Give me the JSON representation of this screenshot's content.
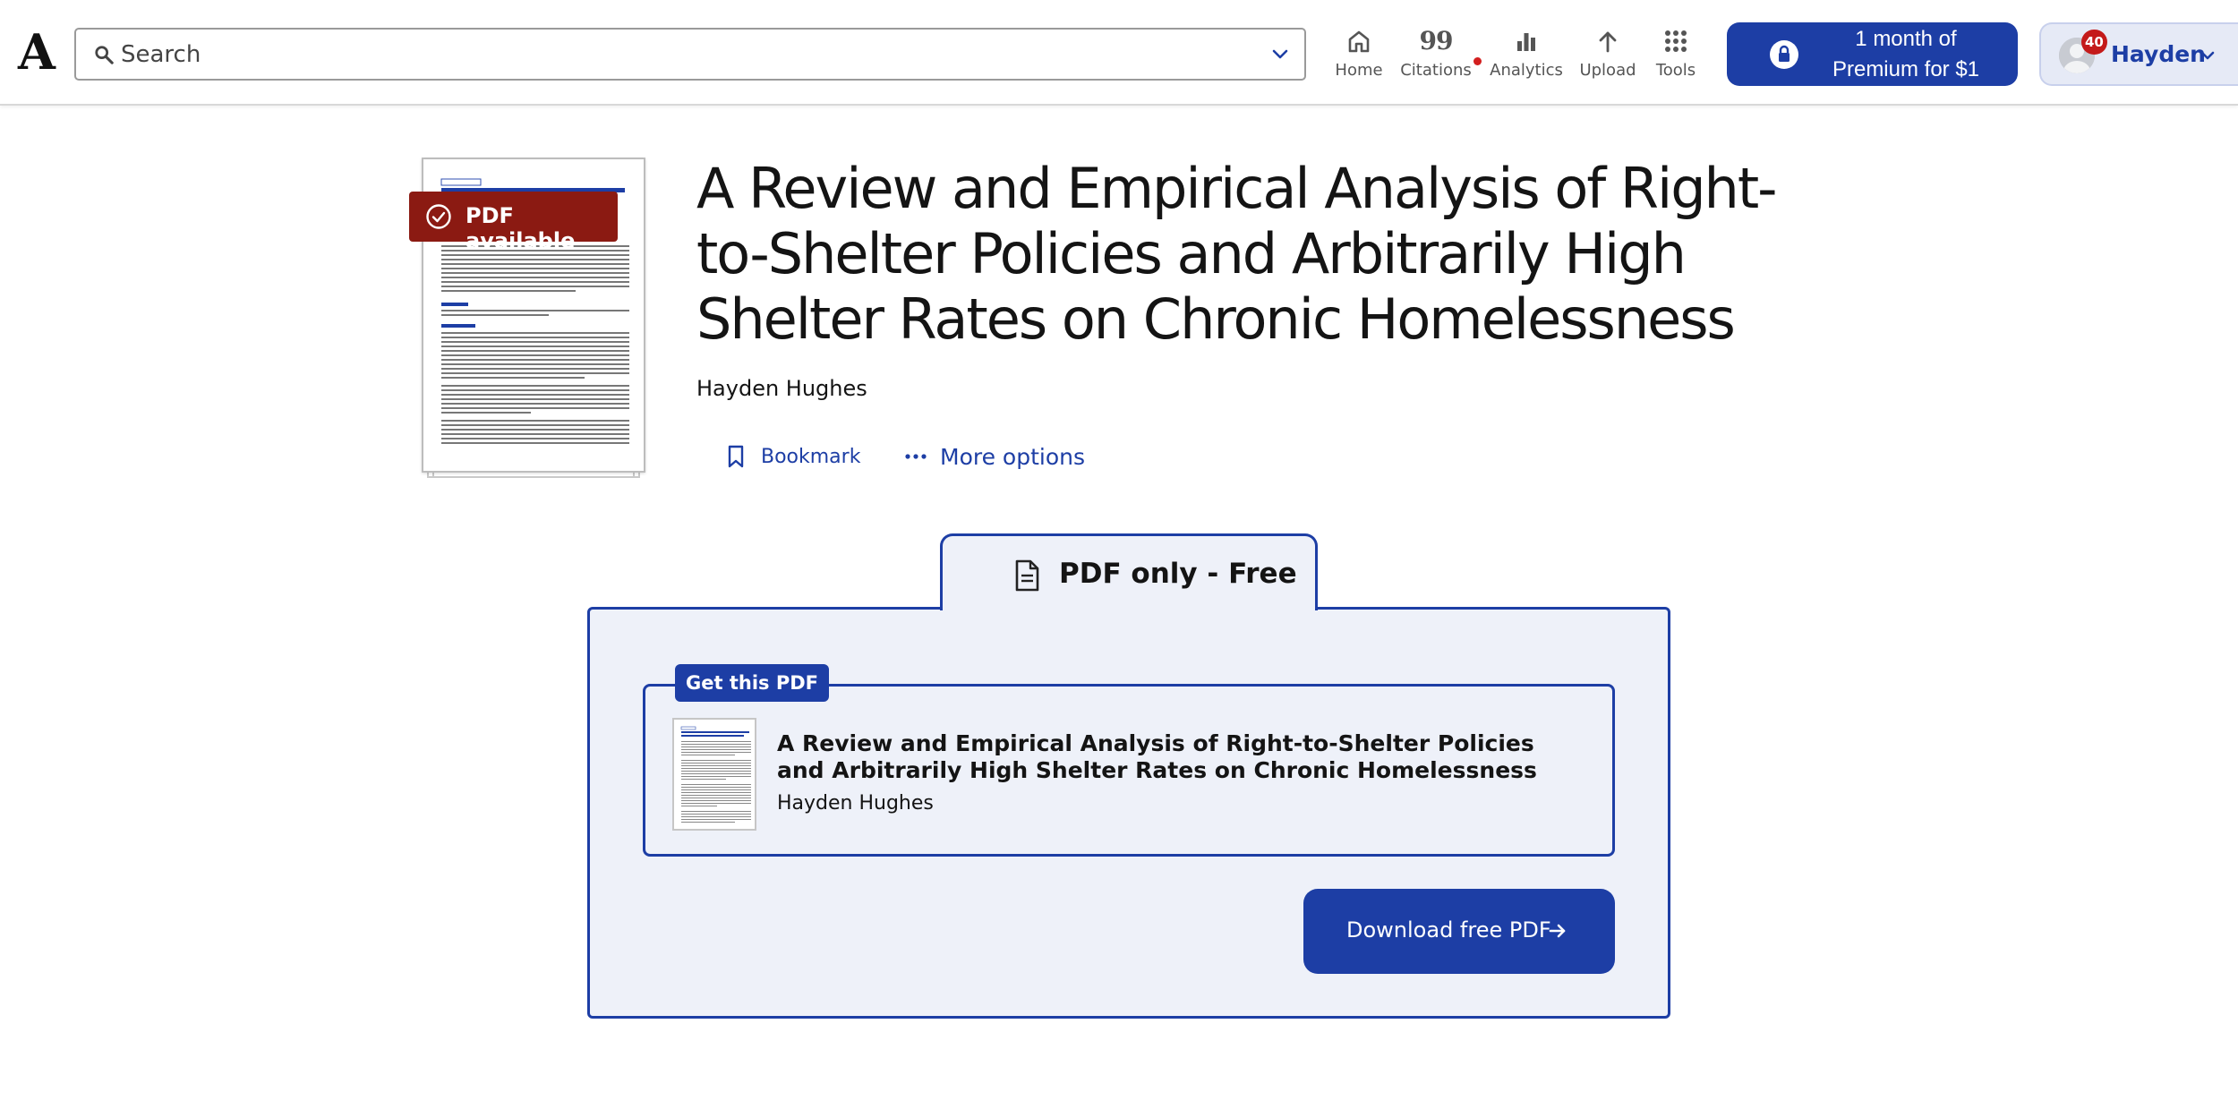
{
  "header": {
    "logo_text": "A",
    "search": {
      "placeholder": "Search"
    },
    "nav": [
      {
        "label": "Home",
        "icon": "home-icon"
      },
      {
        "label": "Citations",
        "icon": "citations-icon",
        "glyph": "99"
      },
      {
        "label": "Analytics",
        "icon": "analytics-icon"
      },
      {
        "label": "Upload",
        "icon": "upload-icon"
      },
      {
        "label": "Tools",
        "icon": "tools-icon"
      }
    ],
    "premium": {
      "line1": "1 month of",
      "line2": "Premium for $1"
    },
    "user": {
      "name": "Hayden",
      "notification_count": "40"
    }
  },
  "paper": {
    "pdf_badge": "PDF available",
    "title": "A Review and Empirical Analysis of Right-to-Shelter Policies and Arbitrarily High Shelter Rates on Chronic Homelessness",
    "author": "Hayden Hughes",
    "actions": {
      "bookmark": "Bookmark",
      "more_options": "More options"
    }
  },
  "download_panel": {
    "tab_label": "PDF only - Free",
    "card_tag": "Get this PDF",
    "card_title": "A Review and Empirical Analysis of Right-to-Shelter Policies and Arbitrarily High Shelter Rates on Chronic Homelessness",
    "card_author": "Hayden Hughes",
    "download_button": "Download free PDF"
  },
  "colors": {
    "brand_blue": "#1d3ea5",
    "badge_red": "#8b1a12",
    "panel_bg": "#eef1f9",
    "notification_red": "#c41a1a"
  }
}
